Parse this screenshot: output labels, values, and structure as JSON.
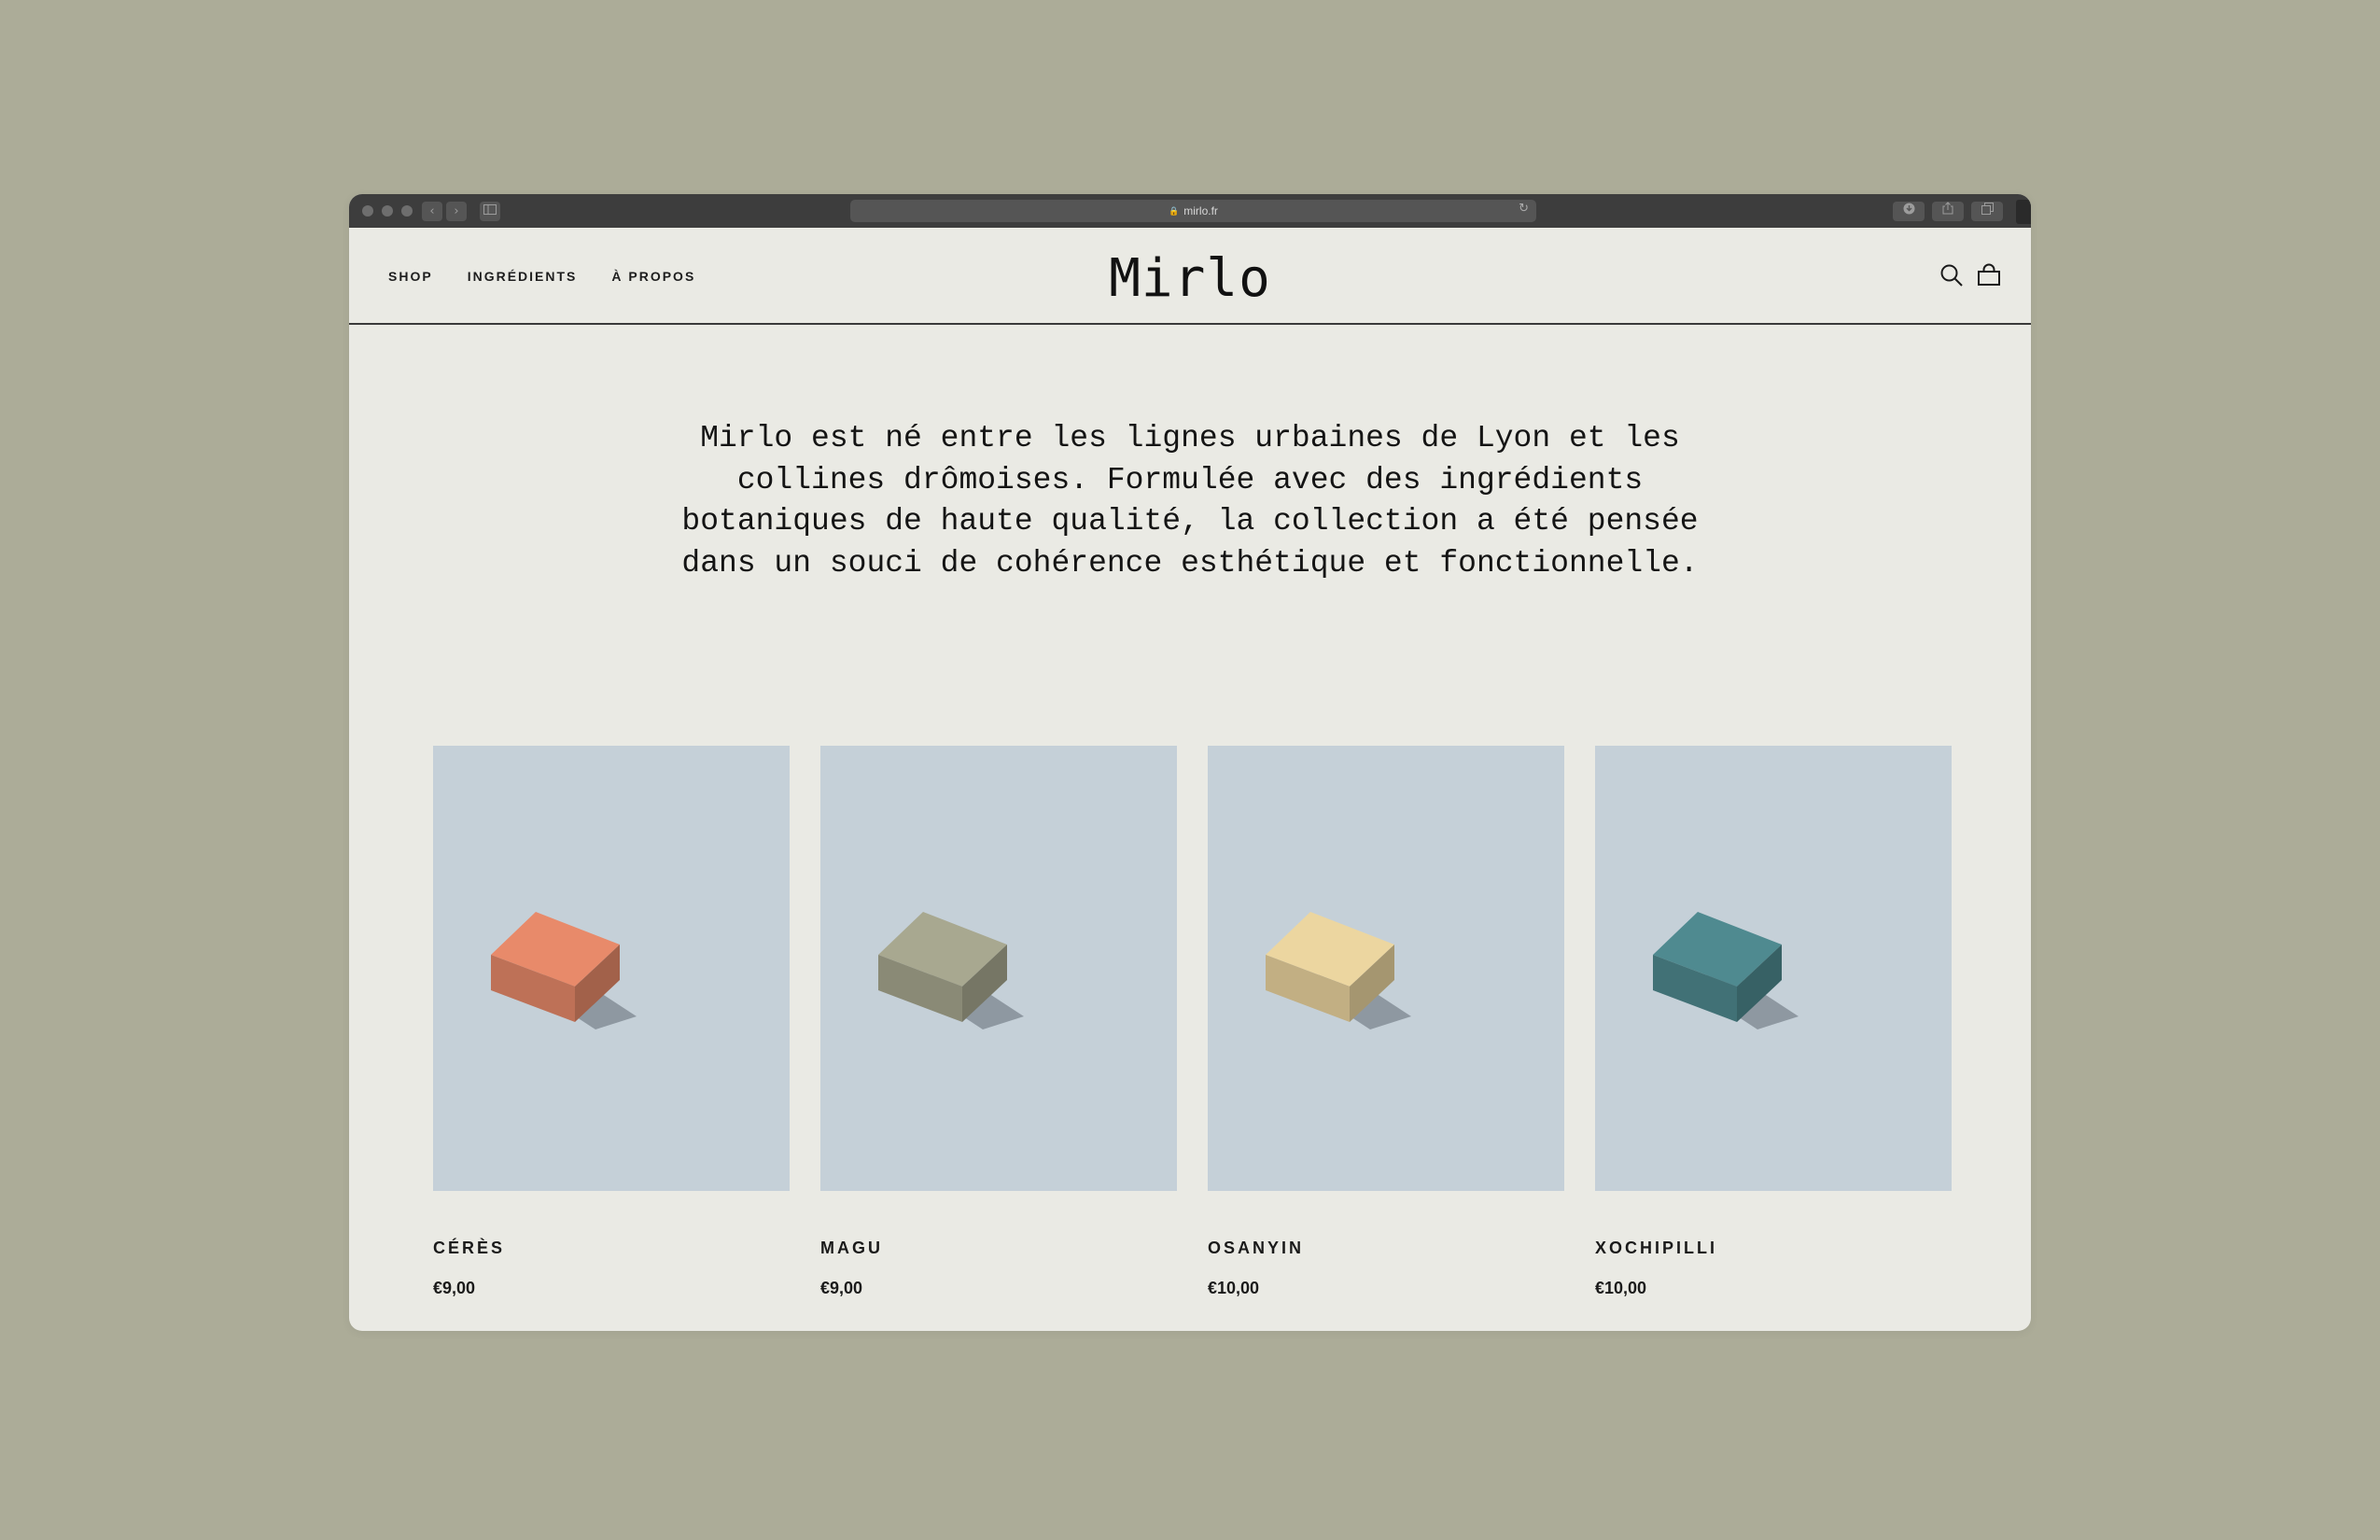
{
  "browser": {
    "url": "mirlo.fr",
    "back_glyph": "‹",
    "forward_glyph": "›",
    "reload_glyph": "↻",
    "lock_glyph": "🔒"
  },
  "nav": {
    "items": [
      {
        "label": "SHOP"
      },
      {
        "label": "INGRÉDIENTS"
      },
      {
        "label": "À PROPOS"
      }
    ]
  },
  "brand": {
    "logo": "Mirlo"
  },
  "intro": {
    "text": "Mirlo est né entre les lignes urbaines de Lyon et les collines drômoises. Formulée avec des ingrédients botaniques de haute qualité, la collection a été pensée dans un souci de cohérence esthétique et fonctionnelle."
  },
  "products": [
    {
      "name": "CÉRÈS",
      "price": "€9,00",
      "soap_color": "#e88a6a"
    },
    {
      "name": "MAGU",
      "price": "€9,00",
      "soap_color": "#a8a890"
    },
    {
      "name": "OSANYIN",
      "price": "€10,00",
      "soap_color": "#ecd6a0"
    },
    {
      "name": "XOCHIPILLI",
      "price": "€10,00",
      "soap_color": "#4f8a90"
    }
  ],
  "colors": {
    "page_background": "#acac98",
    "site_background": "#eaeae4",
    "photo_background": "#c5d0d8",
    "text": "#141414"
  },
  "icons": {
    "search": "search-icon",
    "cart": "bag-icon"
  }
}
